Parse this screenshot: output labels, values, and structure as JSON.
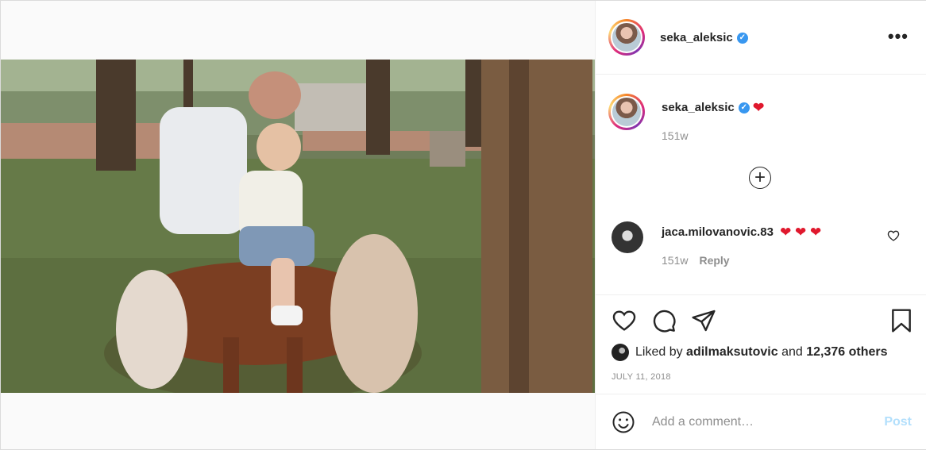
{
  "post": {
    "username": "seka_aleksic",
    "more_icon": "more-options-icon",
    "caption_emoji": "❤",
    "caption_time": "151w",
    "load_more_icon": "plus-circle-icon"
  },
  "comments": [
    {
      "username": "jaca.milovanovic.83",
      "text": "❤ ❤ ❤",
      "time": "151w",
      "reply_label": "Reply"
    }
  ],
  "actions": {
    "like_icon": "heart-icon",
    "comment_icon": "comment-icon",
    "share_icon": "send-icon",
    "save_icon": "bookmark-icon"
  },
  "likes": {
    "prefix": "Liked by ",
    "user": "adilmaksutovic",
    "middle": " and ",
    "count": "12,376 others"
  },
  "date": "JULY 11, 2018",
  "comment_box": {
    "emoji_icon": "smiley-icon",
    "placeholder": "Add a comment…",
    "post_label": "Post"
  },
  "colors": {
    "accent": "#3897f0",
    "heart": "#e0182d",
    "post_disabled": "#b2dffc"
  }
}
